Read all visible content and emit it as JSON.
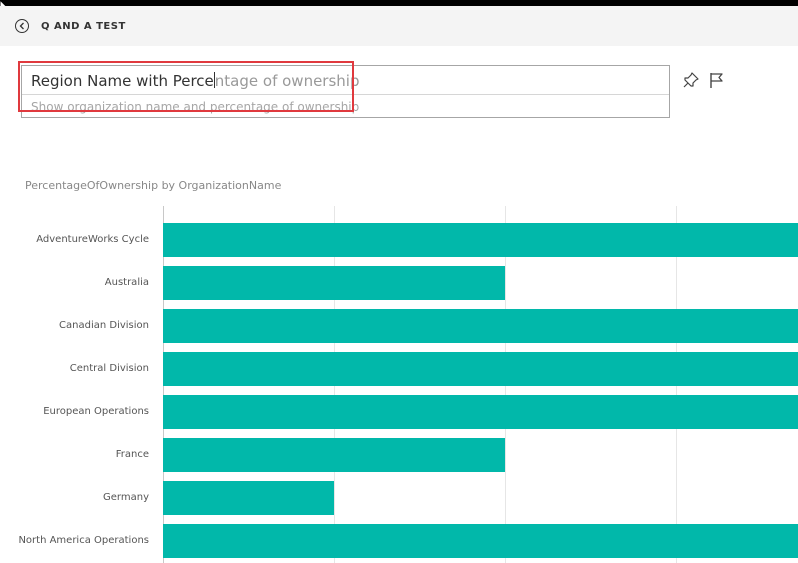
{
  "header": {
    "title": "Q AND A TEST"
  },
  "qa": {
    "typed": "Region Name with Perce",
    "completion": "ntage of ownership",
    "suggestion": "Show organization name and percentage of ownership"
  },
  "icons": {
    "back": "back-circle-icon",
    "pin": "pin-icon",
    "flag": "flag-icon"
  },
  "colors": {
    "bar": "#01b8aa",
    "highlight": "#e0393e"
  },
  "chart_data": {
    "type": "bar",
    "orientation": "horizontal",
    "title": "PercentageOfOwnership by OrganizationName",
    "categories": [
      "AdventureWorks Cycle",
      "Australia",
      "Canadian Division",
      "Central Division",
      "European Operations",
      "France",
      "Germany",
      "North America Operations"
    ],
    "values": [
      1.0,
      0.5,
      1.0,
      1.0,
      1.0,
      0.5,
      0.25,
      1.0
    ],
    "xlim": [
      0,
      0.75
    ],
    "gridlines": 4,
    "grid": true
  }
}
